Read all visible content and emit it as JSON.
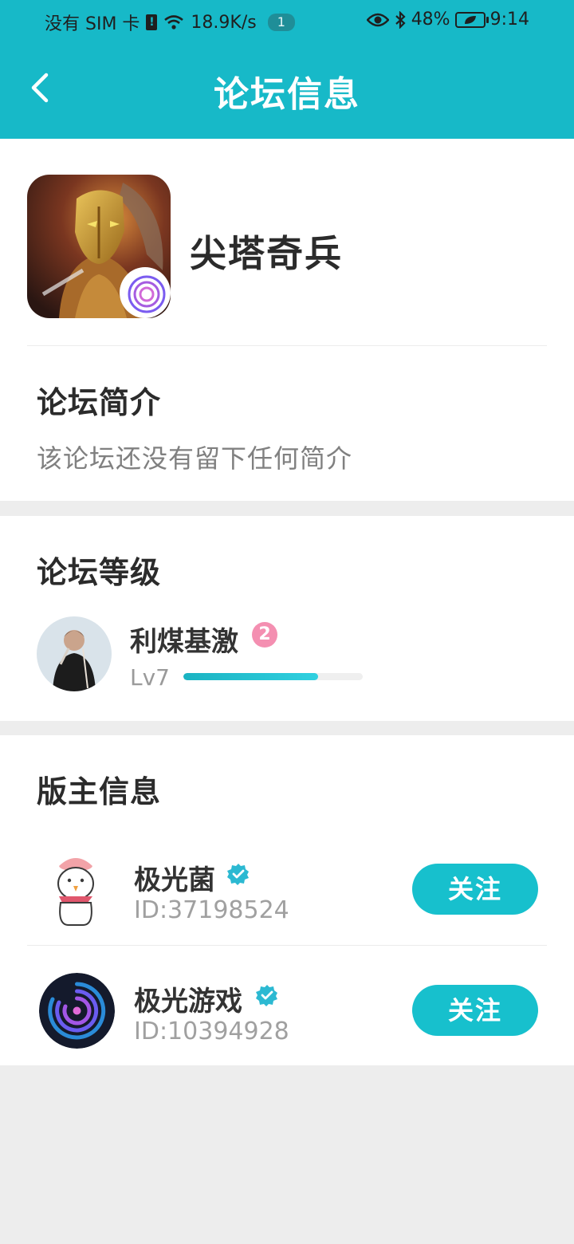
{
  "status_bar": {
    "carrier": "没有 SIM 卡",
    "speed": "18.9K/s",
    "notifications": "1",
    "battery": "48%",
    "time": "9:14"
  },
  "nav": {
    "title": "论坛信息"
  },
  "forum": {
    "name": "尖塔奇兵"
  },
  "intro": {
    "title": "论坛简介",
    "text": "该论坛还没有留下任何简介"
  },
  "level_section": {
    "title": "论坛等级",
    "user": {
      "name": "利煤基激",
      "badge": "2",
      "level": "Lv7",
      "progress": 0.75
    }
  },
  "moderators": {
    "title": "版主信息",
    "items": [
      {
        "name": "极光菌",
        "id": "ID:37198524",
        "follow": "关注"
      },
      {
        "name": "极光游戏",
        "id": "ID:10394928",
        "follow": "关注"
      }
    ]
  },
  "colors": {
    "accent": "#17b9c8",
    "follow_button": "#17c0cd",
    "badge_pink": "#f48fb1"
  }
}
